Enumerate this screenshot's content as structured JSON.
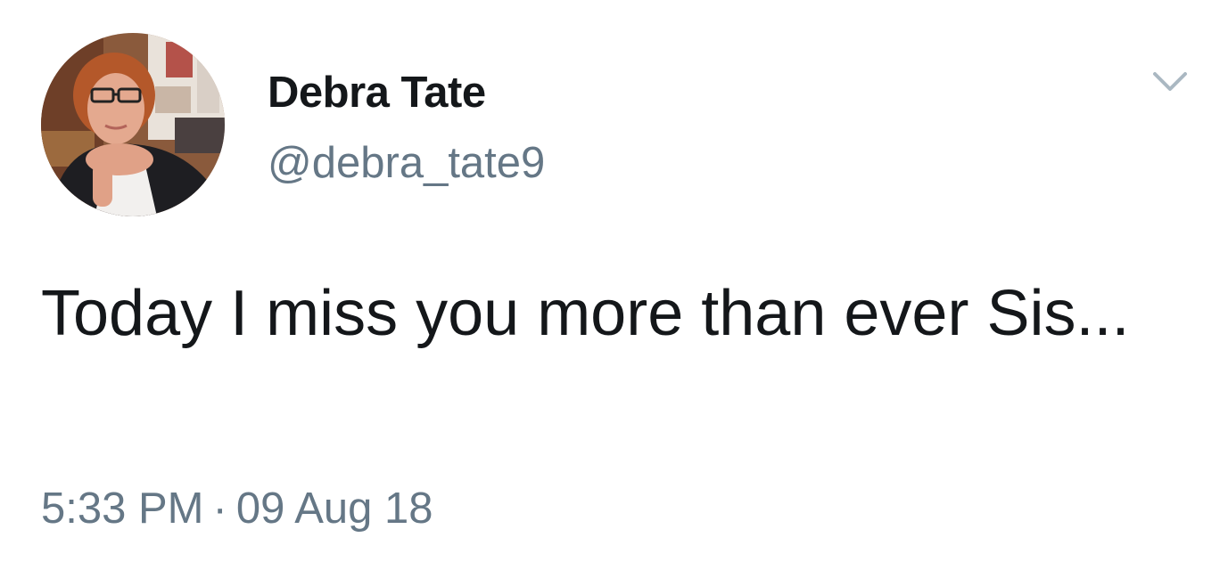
{
  "user": {
    "display_name": "Debra Tate",
    "handle": "@debra_tate9",
    "avatar_icon": "profile-photo"
  },
  "tweet": {
    "text": "Today I miss you more than ever Sis...",
    "time": "5:33 PM",
    "separator": "·",
    "date": "09 Aug 18"
  },
  "menu": {
    "icon": "chevron-down-icon"
  },
  "colors": {
    "text_primary": "#14171a",
    "text_secondary": "#657786",
    "caret": "#aab8c2",
    "background": "#ffffff"
  }
}
